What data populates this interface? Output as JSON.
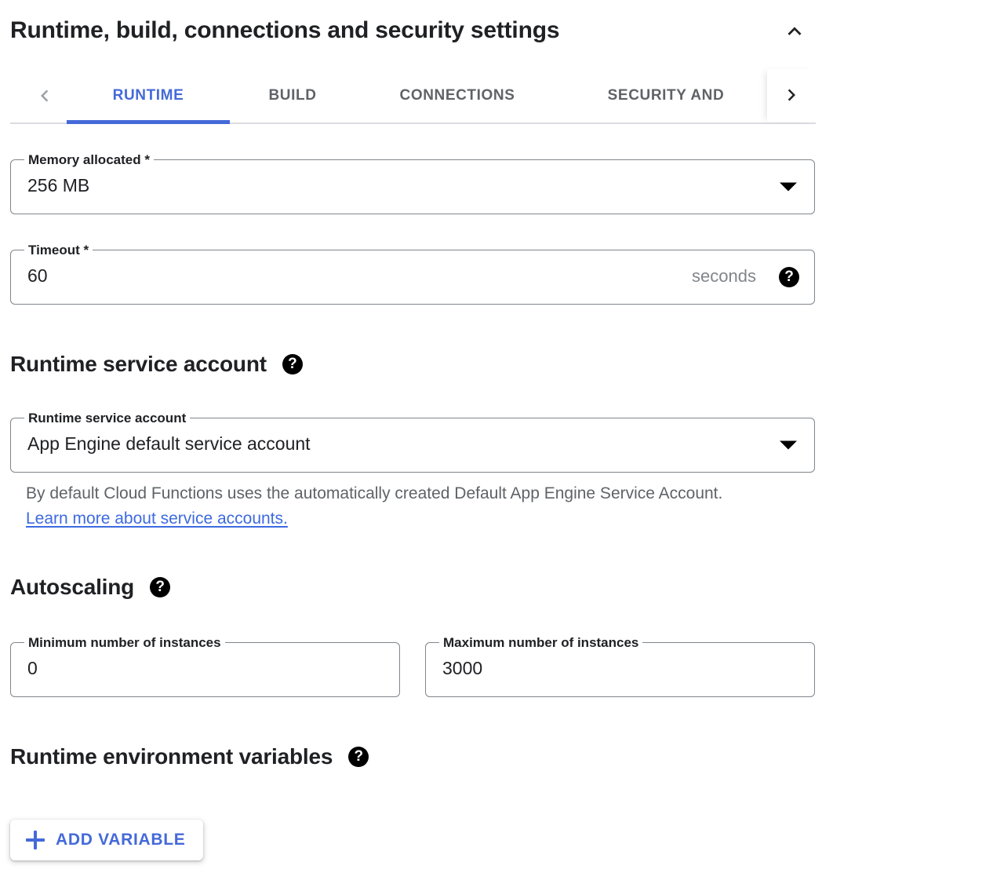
{
  "panel": {
    "title": "Runtime, build, connections and security settings",
    "collapse_icon": "chevron-up-icon"
  },
  "tabs": {
    "scroll_left_icon": "chevron-left-icon",
    "scroll_right_icon": "chevron-right-icon",
    "active_index": 0,
    "accent_color": "#4469d9",
    "items": [
      {
        "label": "RUNTIME"
      },
      {
        "label": "BUILD"
      },
      {
        "label": "CONNECTIONS"
      },
      {
        "label": "SECURITY AND"
      }
    ]
  },
  "runtime": {
    "memory": {
      "label": "Memory allocated *",
      "value": "256 MB",
      "control": "select"
    },
    "timeout": {
      "label": "Timeout *",
      "value": "60",
      "suffix": "seconds",
      "help_icon": "help-icon"
    }
  },
  "service_account": {
    "heading": "Runtime service account",
    "heading_help_icon": "help-icon",
    "field_label": "Runtime service account",
    "field_value": "App Engine default service account",
    "hint_prefix": "By default Cloud Functions uses the automatically created Default App Engine Service Account. ",
    "hint_link": "Learn more about service accounts.",
    "link_color": "#3d6ae0"
  },
  "autoscaling": {
    "heading": "Autoscaling",
    "heading_help_icon": "help-icon",
    "min_instances": {
      "label": "Minimum number of instances",
      "value": "0"
    },
    "max_instances": {
      "label": "Maximum number of instances",
      "value": "3000"
    }
  },
  "env_vars": {
    "heading": "Runtime environment variables",
    "heading_help_icon": "help-icon",
    "add_button_label": "ADD VARIABLE",
    "add_button_icon": "plus-icon"
  }
}
